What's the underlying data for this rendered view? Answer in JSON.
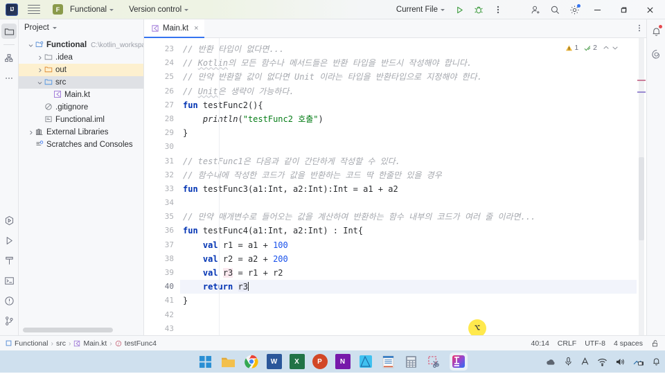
{
  "titlebar": {
    "logo_text": "IJ",
    "menu_icon": "hamburger-menu-icon",
    "project_badge": "F",
    "project_name": "Functional",
    "vcs_label": "Version control",
    "run_config": "Current File",
    "run_icon": "run-icon",
    "debug_icon": "debug-icon",
    "more_icon": "more-vertical-icon",
    "share_icon": "add-user-icon",
    "search_icon": "search-icon",
    "settings_icon": "gear-icon",
    "minimize": "minimize-icon",
    "maximize": "maximize-icon",
    "close": "close-icon"
  },
  "left_rail": {
    "items": [
      {
        "name": "project-tool-window",
        "icon": "folder-icon",
        "active": true
      },
      {
        "name": "commit-tool-window",
        "icon": "structure-icon",
        "active": false
      },
      {
        "name": "more-tool-windows",
        "icon": "more-horizontal-icon",
        "active": false
      }
    ],
    "bottom_items": [
      {
        "name": "services-tool-window",
        "icon": "services-icon"
      },
      {
        "name": "run-tool-window",
        "icon": "run-icon"
      },
      {
        "name": "build-tool-window",
        "icon": "hammer-icon"
      },
      {
        "name": "terminal-tool-window",
        "icon": "terminal-icon"
      },
      {
        "name": "problems-tool-window",
        "icon": "warning-circle-icon"
      },
      {
        "name": "git-tool-window",
        "icon": "git-branch-icon"
      }
    ]
  },
  "right_rail": {
    "items": [
      {
        "name": "notifications",
        "icon": "bell-icon",
        "badge": true
      },
      {
        "name": "ai-assistant",
        "icon": "ai-spiral-icon",
        "badge": false
      }
    ]
  },
  "project_panel": {
    "title": "Project",
    "tree": [
      {
        "label": "Functional",
        "path": "C:\\kotlin_workspace",
        "depth": 0,
        "arrow": "down",
        "icon": "module-folder-icon",
        "bold": true,
        "state": "none"
      },
      {
        "label": ".idea",
        "path": "",
        "depth": 1,
        "arrow": "right",
        "icon": "folder-icon",
        "bold": false,
        "state": "none"
      },
      {
        "label": "out",
        "path": "",
        "depth": 1,
        "arrow": "right",
        "icon": "folder-orange-icon",
        "bold": false,
        "state": "highlight"
      },
      {
        "label": "src",
        "path": "",
        "depth": 1,
        "arrow": "down",
        "icon": "folder-source-icon",
        "bold": false,
        "state": "selected"
      },
      {
        "label": "Main.kt",
        "path": "",
        "depth": 2,
        "arrow": "none",
        "icon": "kotlin-file-icon",
        "bold": false,
        "state": "none"
      },
      {
        "label": ".gitignore",
        "path": "",
        "depth": 1,
        "arrow": "none",
        "icon": "gitignore-icon",
        "bold": false,
        "state": "none"
      },
      {
        "label": "Functional.iml",
        "path": "",
        "depth": 1,
        "arrow": "none",
        "icon": "iml-file-icon",
        "bold": false,
        "state": "none"
      },
      {
        "label": "External Libraries",
        "path": "",
        "depth": 0,
        "arrow": "right",
        "icon": "library-icon",
        "bold": false,
        "state": "none"
      },
      {
        "label": "Scratches and Consoles",
        "path": "",
        "depth": 0,
        "arrow": "none",
        "icon": "scratches-icon",
        "bold": false,
        "state": "none"
      }
    ]
  },
  "editor": {
    "tab": {
      "label": "Main.kt",
      "icon": "kotlin-file-icon",
      "close": "×"
    },
    "tab_more_icon": "more-vertical-icon",
    "inspection": {
      "warning_count": "1",
      "ok_count": "2",
      "prev_icon": "chevron-up-icon",
      "next_icon": "chevron-down-icon"
    },
    "first_line": 23,
    "current_line": 40,
    "lines": [
      {
        "n": 23,
        "html": "<span class='cmt'>// 반환 타입이 없다면...</span>"
      },
      {
        "n": 24,
        "html": "<span class='cmt'>// <u>Kotlin</u>의 모든 함수나 메서드들은 반환 타입을 반드시 작성해야 합니다.</span>"
      },
      {
        "n": 25,
        "html": "<span class='cmt'>// 만약 반환할 값이 없다면 Unit 이라는 타입을 반환타입으로 지정해야 한다.</span>"
      },
      {
        "n": 26,
        "html": "<span class='cmt'>// <u>Unit</u>은 생략이 가능하다.</span>"
      },
      {
        "n": 27,
        "html": "<span class='kw'>fun</span> <span class='fn'>testFunc2</span>(){"
      },
      {
        "n": 28,
        "html": "    <span class='ita'>println</span>(<span class='str'>\"testFunc2 호출\"</span>)"
      },
      {
        "n": 29,
        "html": "}"
      },
      {
        "n": 30,
        "html": ""
      },
      {
        "n": 31,
        "html": "<span class='cmt'>// testFunc1은 다음과 같이 간단하게 작성할 수 있다.</span>"
      },
      {
        "n": 32,
        "html": "<span class='cmt'>// 함수내에 작성한 코드가 값을 반환하는 코드 딱 한줄만 있을 경우</span>"
      },
      {
        "n": 33,
        "html": "<span class='kw'>fun</span> <span class='fn'>testFunc3</span>(a1:Int, a2:Int):Int = a1 + a2"
      },
      {
        "n": 34,
        "html": ""
      },
      {
        "n": 35,
        "html": "<span class='cmt'>// 만약 매개변수로 들어오는 값을 계산하여 반환하는 함수 내부의 코드가 여러 줄 이라면...</span>"
      },
      {
        "n": 36,
        "html": "<span class='kw'>fun</span> <span class='fn'>testFunc4</span>(a1:Int, a2:Int) : Int{"
      },
      {
        "n": 37,
        "html": "    <span class='kw'>val</span> r1 = a1 + <span class='num'>100</span>"
      },
      {
        "n": 38,
        "html": "    <span class='kw'>val</span> r2 = a2 + <span class='num'>200</span>"
      },
      {
        "n": 39,
        "html": "    <span class='kw'>val</span> <span class='mark'>r3</span> = r1 + r2"
      },
      {
        "n": 40,
        "html": "    <span class='kw'>return</span> <span class='mark2'>r3</span><span class='caret'></span>"
      },
      {
        "n": 41,
        "html": "}"
      },
      {
        "n": 42,
        "html": ""
      },
      {
        "n": 43,
        "html": ""
      }
    ]
  },
  "status_bar": {
    "breadcrumb": [
      {
        "label": "Functional",
        "icon": "module-icon"
      },
      {
        "label": "src",
        "icon": "none"
      },
      {
        "label": "Main.kt",
        "icon": "kotlin-file-icon"
      },
      {
        "label": "testFunc4",
        "icon": "function-icon"
      }
    ],
    "separator": "›",
    "caret_position": "40:14",
    "line_separator": "CRLF",
    "encoding": "UTF-8",
    "indent": "4 spaces",
    "lock_icon": "unlocked-icon"
  },
  "taskbar": {
    "apps": [
      {
        "name": "start-button",
        "label": "windows-icon"
      },
      {
        "name": "file-explorer",
        "label": "explorer-icon"
      },
      {
        "name": "google-chrome",
        "label": "chrome-icon"
      },
      {
        "name": "microsoft-word",
        "label": "W"
      },
      {
        "name": "microsoft-excel",
        "label": "X"
      },
      {
        "name": "microsoft-powerpoint",
        "label": "P"
      },
      {
        "name": "microsoft-onenote",
        "label": "N"
      },
      {
        "name": "affinity-designer",
        "label": "affinity-icon"
      },
      {
        "name": "notepad",
        "label": "notepad-icon"
      },
      {
        "name": "calculator",
        "label": "calculator-icon"
      },
      {
        "name": "snipping-tool",
        "label": "snip-icon"
      },
      {
        "name": "intellij-idea",
        "label": "IJ"
      }
    ],
    "tray": [
      {
        "name": "cloud-sync-icon"
      },
      {
        "name": "microphone-icon"
      },
      {
        "name": "ime-language-icon"
      },
      {
        "name": "wifi-icon"
      },
      {
        "name": "volume-icon"
      },
      {
        "name": "network-icon"
      },
      {
        "name": "notification-bell-icon"
      }
    ]
  },
  "colors": {
    "accent": "#3574f0",
    "keyword": "#0033b3",
    "string": "#067d17",
    "number": "#1750eb",
    "comment": "#a5a8ae",
    "taskbar": "#cfe0ee",
    "panel": "#f7f8fa"
  }
}
